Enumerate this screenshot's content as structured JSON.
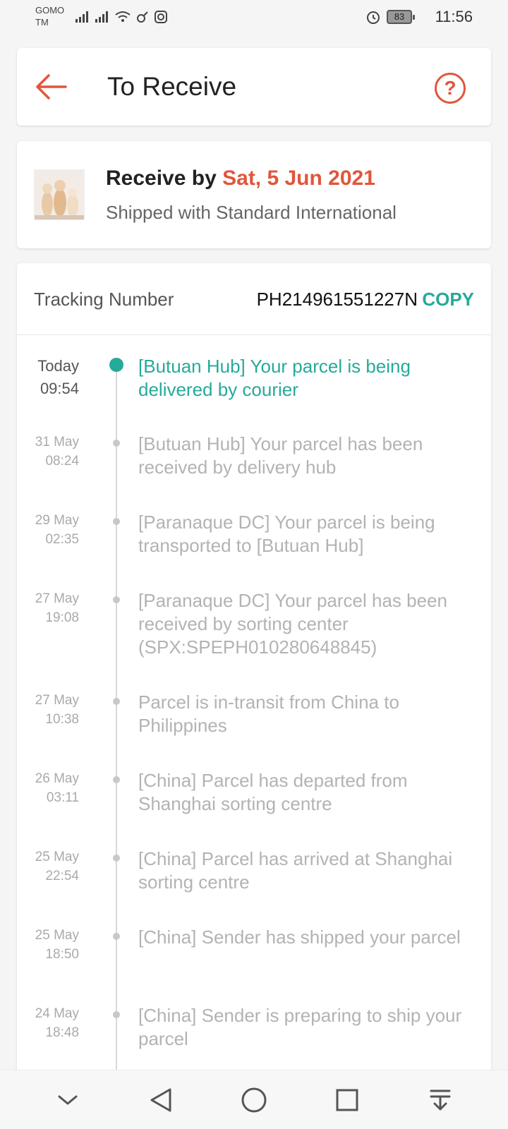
{
  "status_bar": {
    "carrier": "GOMO TM",
    "battery": "83",
    "time": "11:56"
  },
  "header": {
    "title": "To Receive",
    "help_label": "?"
  },
  "delivery": {
    "receive_prefix": "Receive by",
    "receive_date": "Sat, 5 Jun 2021",
    "shipping_method": "Shipped with Standard International"
  },
  "tracking": {
    "label": "Tracking Number",
    "number": "PH214961551227N",
    "copy_label": "COPY",
    "events": [
      {
        "day": "Today",
        "time": "09:54",
        "text": "[Butuan Hub] Your parcel is being delivered by courier"
      },
      {
        "day": "31 May",
        "time": "08:24",
        "text": "[Butuan Hub] Your parcel has been received by delivery hub"
      },
      {
        "day": "29 May",
        "time": "02:35",
        "text": "[Paranaque DC] Your parcel is being transported to [Butuan Hub]"
      },
      {
        "day": "27 May",
        "time": "19:08",
        "text": "[Paranaque DC] Your parcel has been received by sorting center (SPX:SPEPH010280648845)"
      },
      {
        "day": "27 May",
        "time": "10:38",
        "text": "Parcel is in-transit from China to Philippines"
      },
      {
        "day": "26 May",
        "time": "03:11",
        "text": "[China] Parcel has departed from Shanghai sorting centre"
      },
      {
        "day": "25 May",
        "time": "22:54",
        "text": "[China] Parcel has arrived at Shanghai sorting centre"
      },
      {
        "day": "25 May",
        "time": "18:50",
        "text": "[China] Sender has shipped your parcel"
      },
      {
        "day": "24 May",
        "time": "18:48",
        "text": "[China] Sender is preparing to ship your parcel"
      }
    ]
  },
  "colors": {
    "accent_orange": "#e0563b",
    "accent_teal": "#26aa99"
  }
}
